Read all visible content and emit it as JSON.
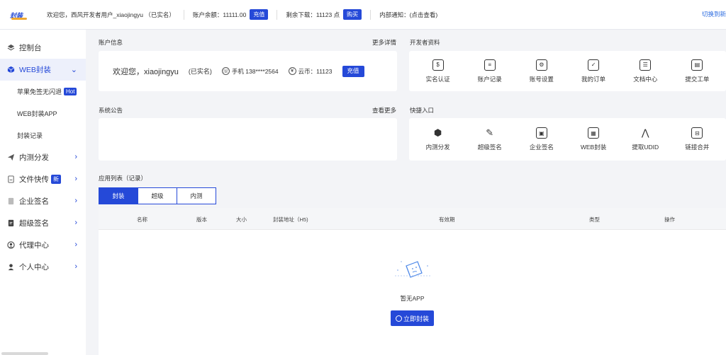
{
  "topbar": {
    "logo_text": "封装",
    "welcome": "欢迎您，西风开发者用户_xiaojingyu （已实名）",
    "balance_label": "账户余额：11111.00",
    "recharge_btn": "充值",
    "downloads_label": "剩余下载：11123 点",
    "buy_btn": "购买",
    "notice_label": "内部通知：(点击查看)",
    "switch_label": "切换到新"
  },
  "sidebar": {
    "items": [
      {
        "label": "控制台",
        "icon": "layers-icon"
      },
      {
        "label": "WEB封装",
        "icon": "box-icon"
      },
      {
        "label": "苹果免签无闪退",
        "badge": "Hot"
      },
      {
        "label": "WEB封装APP"
      },
      {
        "label": "封装记录"
      },
      {
        "label": "内测分发",
        "icon": "send-icon"
      },
      {
        "label": "文件快传",
        "icon": "file-icon",
        "badge": "新"
      },
      {
        "label": "企业签名",
        "icon": "doc-icon"
      },
      {
        "label": "超级签名",
        "icon": "sign-icon"
      },
      {
        "label": "代理中心",
        "icon": "agent-icon"
      },
      {
        "label": "个人中心",
        "icon": "user-icon"
      }
    ]
  },
  "account": {
    "title": "账户信息",
    "more": "更多详情",
    "welcome": "欢迎您，xiaojingyu",
    "verified": "(已实名)",
    "phone": "手机 138****2564",
    "coins": "云币：11123",
    "recharge_btn": "充值"
  },
  "dev": {
    "title": "开发者资料",
    "items": [
      "实名认证",
      "账户记录",
      "账号设置",
      "我的订单",
      "文档中心",
      "提交工单"
    ]
  },
  "notice": {
    "title": "系统公告",
    "more": "查看更多"
  },
  "quick": {
    "title": "快捷入口",
    "items": [
      "内测分发",
      "超级签名",
      "企业签名",
      "WEB封装",
      "提取UDID",
      "链接合并"
    ]
  },
  "apps": {
    "title": "应用列表（记录）",
    "tabs": [
      "封装",
      "超级",
      "内测"
    ],
    "columns": [
      "名称",
      "版本",
      "大小",
      "封装地址（H5)",
      "有效期",
      "类型",
      "操作"
    ],
    "empty_text": "暂无APP",
    "pack_btn": "立即封装"
  },
  "colors": {
    "accent": "#2549d8",
    "background": "#f3f4f7"
  }
}
